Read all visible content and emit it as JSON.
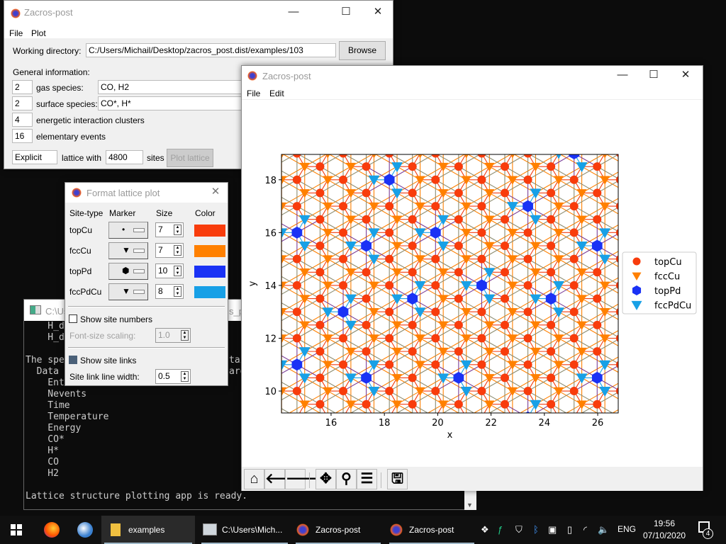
{
  "main_window": {
    "title": "Zacros-post",
    "menu": [
      "File",
      "Plot"
    ],
    "working_directory_label": "Working directory:",
    "working_directory": "C:/Users/Michail/Desktop/zacros_post.dist/examples/103",
    "browse_label": "Browse",
    "general_info_label": "General information:",
    "rows": [
      {
        "count": "2",
        "label": "gas species:",
        "value": "CO, H2"
      },
      {
        "count": "2",
        "label": "surface species:",
        "value": "CO*, H*"
      },
      {
        "count": "4",
        "label": "energetic interaction clusters"
      },
      {
        "count": "16",
        "label": "elementary events"
      }
    ],
    "lattice_type": "Explicit",
    "lattice_with_label": "lattice with",
    "sites_count": "4800",
    "sites_label": "sites",
    "plot_lattice_label": "Plot lattice"
  },
  "console": {
    "title": "C:\\Us",
    "title_tail": "s_po",
    "lines": [
      "    H_d",
      "    H_d",
      "",
      "The spe",
      "  Data ",
      "    Ent",
      "    Nevents",
      "    Time",
      "    Temperature",
      "    Energy",
      "    CO*",
      "    H*",
      "    CO",
      "    H2",
      "",
      "Lattice structure plotting app is ready."
    ],
    "tail_fragments": [
      "tai",
      "are"
    ]
  },
  "format_dialog": {
    "title": "Format lattice plot",
    "headers": [
      "Site-type",
      "Marker",
      "Size",
      "Color"
    ],
    "rows": [
      {
        "site": "topCu",
        "marker": "•",
        "size": "7",
        "color": "#f83c0c"
      },
      {
        "site": "fccCu",
        "marker": "▼",
        "size": "7",
        "color": "#ff8000"
      },
      {
        "site": "topPd",
        "marker": "⬢",
        "size": "10",
        "color": "#1a32f5"
      },
      {
        "site": "fccPdCu",
        "marker": "▼",
        "size": "8",
        "color": "#18a0e6"
      }
    ],
    "show_site_numbers_label": "Show site numbers",
    "show_site_numbers": false,
    "font_scaling_label": "Font-size scaling:",
    "font_scaling": "1.0",
    "show_site_links_label": "Show site links",
    "show_site_links": true,
    "link_width_label": "Site link line width:",
    "link_width": "0.5"
  },
  "plot_window": {
    "title": "Zacros-post",
    "menu": [
      "File",
      "Edit"
    ],
    "toolbar": [
      "home-icon",
      "back-icon",
      "forward-icon",
      "pan-icon",
      "zoom-icon",
      "configure-icon",
      "save-icon"
    ]
  },
  "chart_data": {
    "type": "scatter",
    "xlabel": "x",
    "ylabel": "y",
    "xlim": [
      14.14,
      26.77
    ],
    "ylim": [
      9.17,
      18.96
    ],
    "xticks": [
      16,
      18,
      20,
      22,
      24,
      26
    ],
    "yticks": [
      10,
      12,
      14,
      16,
      18
    ],
    "legend": {
      "placement": "right",
      "entries": [
        "topCu",
        "fccCu",
        "topPd",
        "fccPdCu"
      ]
    },
    "lattice": {
      "a1": [
        0.866,
        0.5
      ],
      "a2": [
        0,
        1
      ],
      "origin": [
        18.186,
        18.0
      ],
      "fcc_offset": [
        -0.577,
        0
      ]
    },
    "topPd": [
      [
        18.19,
        18.0
      ],
      [
        23.38,
        17.0
      ],
      [
        14.72,
        16.0
      ],
      [
        19.92,
        16.0
      ],
      [
        17.32,
        15.5
      ],
      [
        25.98,
        15.5
      ],
      [
        21.65,
        14.0
      ],
      [
        19.05,
        13.5
      ],
      [
        24.25,
        13.5
      ],
      [
        16.45,
        13.0
      ],
      [
        14.72,
        11.0
      ],
      [
        17.32,
        10.5
      ],
      [
        20.78,
        10.5
      ],
      [
        25.98,
        10.5
      ],
      [
        25.11,
        19.0
      ],
      [
        23.38,
        9.0
      ]
    ],
    "colors": {
      "topCu": "#f83c0c",
      "fccCu": "#ff8000",
      "topPd": "#1a32f5",
      "fccPdCu": "#18a0e6",
      "link_top": "#f03c10",
      "link_pd": "#7a3c96",
      "link_hollow": "#8c8c70",
      "link_fcc": "#ff8000",
      "link_pdcu": "#1aa0e8"
    }
  },
  "taskbar": {
    "tasks": [
      "examples",
      "C:\\Users\\Mich...",
      "Zacros-post",
      "Zacros-post"
    ],
    "language": "ENG",
    "time": "19:56",
    "date": "07/10/2020",
    "notifications": "4"
  }
}
